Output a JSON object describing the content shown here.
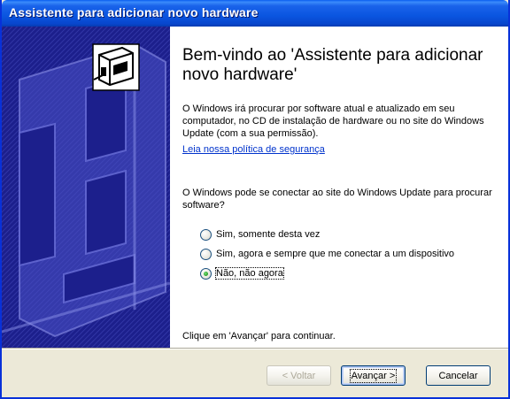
{
  "window": {
    "title": "Assistente para adicionar novo hardware"
  },
  "welcome": {
    "heading": "Bem-vindo ao 'Assistente para adicionar novo hardware'",
    "intro": "O Windows irá procurar por software atual e atualizado em seu computador, no CD de instalação de hardware ou no site do Windows Update (com a sua permissão).",
    "privacy_link": "Leia nossa política de segurança",
    "question": "O Windows pode se conectar ao site do Windows Update para procurar software?",
    "options": [
      {
        "label": "Sim, somente desta vez",
        "checked": false
      },
      {
        "label": "Sim, agora e sempre que me conectar a um dispositivo",
        "checked": false
      },
      {
        "label": "Não, não agora",
        "checked": true
      }
    ],
    "footer_hint": "Clique em 'Avançar' para continuar."
  },
  "buttons": {
    "back": "< Voltar",
    "next": "Avançar >",
    "cancel": "Cancelar"
  },
  "icons": {
    "side_panel": "hardware-wizard-banner",
    "device": "hardware-card-icon"
  },
  "colors": {
    "title_bar": "#0a55e0",
    "side_panel": "#1c1f8c",
    "link": "#0033cc",
    "dialog_face": "#ece9d8"
  }
}
